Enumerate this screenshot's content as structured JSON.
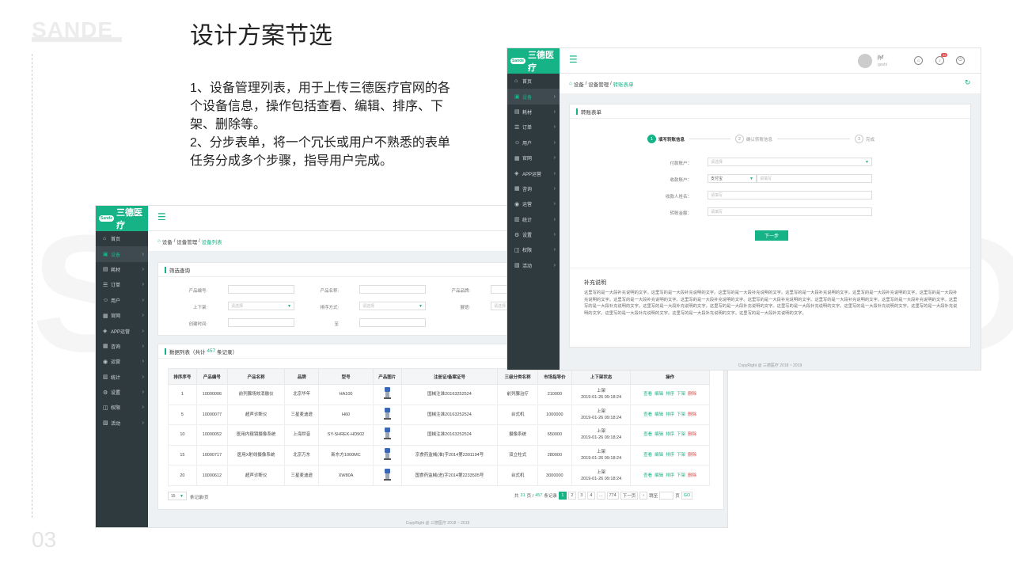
{
  "slide": {
    "brand": "SANDE",
    "page_number": "03",
    "title": "设计方案节选",
    "description": [
      "1、设备管理列表，用于上传三德医疗官网的各个设备信息，操作包括查看、编辑、排序、下架、删除等。",
      "2、分步表单，将一个冗长或用户不熟悉的表单任务分成多个步骤，指导用户完成。"
    ],
    "watermark_left": "S",
    "watermark_right": "D"
  },
  "app": {
    "logo_badge": "Sande",
    "logo_text": "三德医疗",
    "nav": [
      {
        "icon": "⌂",
        "label": "首页",
        "chev": ""
      },
      {
        "icon": "▣",
        "label": "设备",
        "chev": "›"
      },
      {
        "icon": "▤",
        "label": "耗材",
        "chev": "›"
      },
      {
        "icon": "☰",
        "label": "订单",
        "chev": "›"
      },
      {
        "icon": "☺",
        "label": "用户",
        "chev": "›"
      },
      {
        "icon": "▦",
        "label": "官网",
        "chev": "›"
      },
      {
        "icon": "◈",
        "label": "APP运营",
        "chev": "›"
      },
      {
        "icon": "▦",
        "label": "咨询",
        "chev": "›"
      },
      {
        "icon": "◉",
        "label": "运营",
        "chev": "›"
      },
      {
        "icon": "▥",
        "label": "统计",
        "chev": "›"
      },
      {
        "icon": "⚙",
        "label": "设置",
        "chev": "›"
      },
      {
        "icon": "◫",
        "label": "权限",
        "chev": "›"
      },
      {
        "icon": "▧",
        "label": "活动",
        "chev": "›"
      }
    ],
    "copyright": "CopyRight @ 三德医疗 2018 ~ 2019"
  },
  "list_page": {
    "breadcrumb": {
      "a": "设备",
      "b": "设备管理",
      "c": "设备列表",
      "sep": "/"
    },
    "filter": {
      "title": "筛选查询",
      "labels": [
        "产品编号:",
        "产品名称:",
        "产品品牌:",
        "上下架:",
        "排序方式:",
        "展馆:",
        "创建时间:",
        "至"
      ],
      "select_placeholder": "请选择"
    },
    "data_title_prefix": "数据列表（共计",
    "data_count": "457",
    "data_title_suffix": "条记录）",
    "columns": [
      "排序序号",
      "产品编号",
      "产品名称",
      "品牌",
      "型号",
      "产品图片",
      "注册证/备案证号",
      "三级分类名称",
      "市场指导价",
      "上下架状态",
      "操作"
    ],
    "rows": [
      {
        "seq": "1",
        "code": "10000006",
        "name": "前列腺场效消融仪",
        "brand": "北京华年",
        "model": "HA100",
        "reg": "国械注准20163252524",
        "cat": "前列腺治疗",
        "price": "210000",
        "status": "上架",
        "date": "2019-01-26 09:18:24"
      },
      {
        "seq": "5",
        "code": "10000077",
        "name": "超声诊断仪",
        "brand": "三星麦迪逊",
        "model": "H60",
        "reg": "国械注准20163252524",
        "cat": "台式机",
        "price": "1000000",
        "status": "上架",
        "date": "2019-01-26 09:18:24"
      },
      {
        "seq": "10",
        "code": "10000052",
        "name": "医用内窥镜摄像系统",
        "brand": "上海世音",
        "model": "SY-SHREK-HD902",
        "reg": "国械注准20163252524",
        "cat": "摄像系统",
        "price": "650000",
        "status": "上架",
        "date": "2019-01-26 09:18:24"
      },
      {
        "seq": "15",
        "code": "10000717",
        "name": "医用X射线摄像系统",
        "brand": "北京万东",
        "model": "新东方1000MC",
        "reg": "京食药监械(准)字2014第2301194号",
        "cat": "双立柱式",
        "price": "280000",
        "status": "上架",
        "date": "2019-01-26 09:18:24"
      },
      {
        "seq": "20",
        "code": "10000612",
        "name": "超声诊断仪",
        "brand": "三星麦迪逊",
        "model": "XW80A",
        "reg": "国食药监械(进)字2014第2233505号",
        "cat": "台式机",
        "price": "3000000",
        "status": "上架",
        "date": "2019-01-26 09:18:24"
      }
    ],
    "ops": [
      "查看",
      "编辑",
      "排序",
      "下架",
      "删除"
    ],
    "page_size": "15",
    "page_size_suffix": "条记录/页",
    "pager": {
      "total_prefix": "共",
      "pages": "31",
      "pages_suffix": "页 /",
      "records": "457",
      "records_suffix": "条记录",
      "nums": [
        "1",
        "2",
        "3",
        "4",
        "...",
        "774"
      ],
      "next": "下一页",
      "jump": "跳至",
      "page_unit": "页",
      "go": "GO"
    }
  },
  "form_page": {
    "user_name": "jlyf",
    "user_sub": "geshi",
    "notify_count": "99",
    "breadcrumb": {
      "a": "设备",
      "b": "设备管理",
      "c": "转账表单",
      "sep": "/"
    },
    "card_title": "转账表单",
    "steps": [
      {
        "num": "1",
        "label": "填写转账信息"
      },
      {
        "num": "2",
        "label": "确认转账信息"
      },
      {
        "num": "3",
        "label": "完成"
      }
    ],
    "fields": {
      "payer_label": "付款账户：",
      "payer_placeholder": "请选择",
      "payee_label": "收款账户：",
      "payee_type": "支付宝",
      "payee_placeholder": "请填写",
      "name_label": "收款人姓名：",
      "name_placeholder": "请填写",
      "amount_label": "转账金额：",
      "amount_placeholder": "请填写"
    },
    "next_button": "下一步",
    "note_title": "补充说明",
    "note_text": "这里写的是一大段补充说明的文字。这里写的是一大段补充说明的文字。这里写的是一大段补充说明的文字。这里写的是一大段补充说明的文字。这里写的是一大段补充说明的文字。这里写的是一大段补充说明的文字。这里写的是一大段补充说明的文字。这里写的是一大段补充说明的文字。这里写的是一大段补充说明的文字。这里写的是一大段补充说明的文字。这里写的是一大段补充说明的文字。这里写的是一大段补充说明的文字。这里写的是一大段补充说明的文字。这里写的是一大段补充说明的文字。这里写的是一大段补充说明的文字。这里写的是一大段补充说明的文字。这里写的是一大段补充说明的文字。这里写的是一大段补充说明的文字。这里写的是一大段补充说明的文字。这里写的是一大段补充说明的文字。"
  },
  "colors": {
    "accent": "#16b387",
    "sidebar": "#2f3a3f",
    "danger": "#e04848"
  }
}
